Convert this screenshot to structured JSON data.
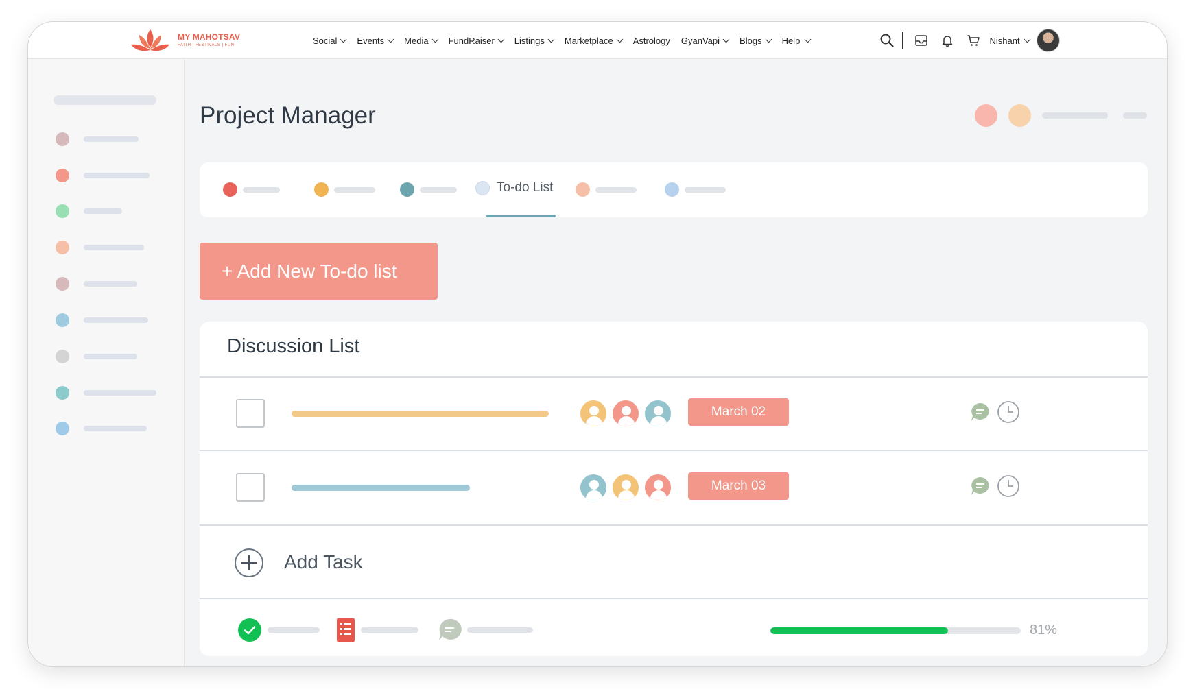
{
  "brand": {
    "name": "MY MAHOTSAV",
    "tagline": "FAITH | FESTIVALS | FUN",
    "color": "#e8604c"
  },
  "nav": {
    "items": [
      {
        "label": "Social",
        "has_menu": true
      },
      {
        "label": "Events",
        "has_menu": true
      },
      {
        "label": "Media",
        "has_menu": true
      },
      {
        "label": "FundRaiser",
        "has_menu": true
      },
      {
        "label": "Listings",
        "has_menu": true
      },
      {
        "label": "Marketplace",
        "has_menu": true
      },
      {
        "label": "Astrology",
        "has_menu": false
      },
      {
        "label": "GyanVapi",
        "has_menu": true
      },
      {
        "label": "Blogs",
        "has_menu": true
      },
      {
        "label": "Help",
        "has_menu": true
      }
    ],
    "icons": [
      "search-icon",
      "inbox-icon",
      "bell-icon",
      "cart-icon"
    ],
    "user": {
      "name": "Nishant"
    }
  },
  "sidebar": {
    "item_colors": [
      "#d5b9bb",
      "#f2978a",
      "#98dfb4",
      "#f6c0a8",
      "#d5b9bb",
      "#9fcbe0",
      "#d4d4d4",
      "#8ccbcb",
      "#9fcbe8"
    ]
  },
  "page": {
    "title": "Project Manager",
    "header_dot_colors": [
      "#f8b6ad",
      "#f8d2aa"
    ]
  },
  "tabs": {
    "active_label": "To-do List",
    "dot_colors": [
      "#e9635a",
      "#f0b453",
      "#6da5ae",
      "#dbe6f4",
      "#f6c0a8",
      "#b7d2ee"
    ]
  },
  "actions": {
    "add_todo_label": "+ Add New To-do list"
  },
  "discussion": {
    "title": "Discussion List",
    "tasks": [
      {
        "bar_color": "#f3c98a",
        "assignee_colors": [
          "#f3c377",
          "#f2978a",
          "#93c3cc"
        ],
        "date": "March 02"
      },
      {
        "bar_color": "#9fc9d6",
        "assignee_colors": [
          "#93c3cc",
          "#f3c377",
          "#f2978a"
        ],
        "date": "March 03"
      }
    ],
    "add_task_label": "Add Task"
  },
  "footer": {
    "progress_percent": 71,
    "progress_text": "81%",
    "progress_color": "#13c053"
  }
}
